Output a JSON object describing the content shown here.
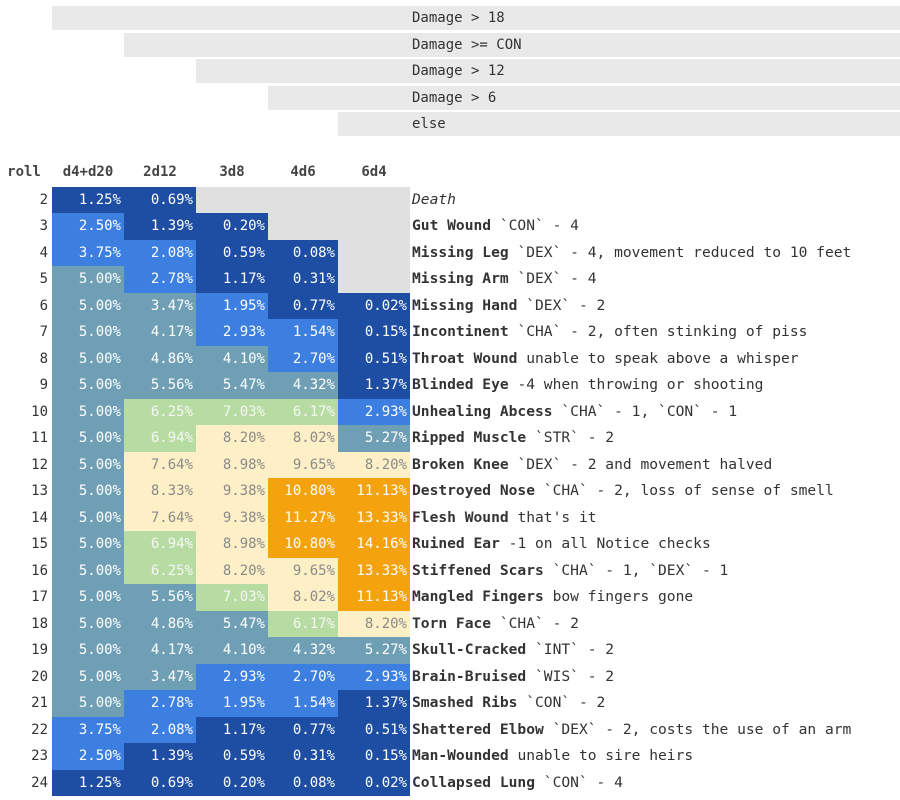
{
  "conditions": [
    "Damage > 18",
    "Damage >= CON",
    "Damage > 12",
    "Damage > 6",
    "else"
  ],
  "headers": [
    "roll",
    "d4+d20",
    "2d12",
    "3d8",
    "4d6",
    "6d4"
  ],
  "colors": {
    "dark_blue": "#1d4ea3",
    "mid_blue": "#3d7fe0",
    "slate_blue": "#6f9fb5",
    "light_green": "#b7dca1",
    "cream": "#fdf0c6",
    "orange": "#f4a20d",
    "gray_bar": "#e9e9e9"
  },
  "rows": [
    {
      "roll": "2",
      "cells": [
        "1.25%",
        "0.69%",
        "",
        "",
        ""
      ],
      "name": "Death",
      "detail": "",
      "italic": true
    },
    {
      "roll": "3",
      "cells": [
        "2.50%",
        "1.39%",
        "0.20%",
        "",
        ""
      ],
      "name": "Gut Wound",
      "detail": " `CON` - 4"
    },
    {
      "roll": "4",
      "cells": [
        "3.75%",
        "2.08%",
        "0.59%",
        "0.08%",
        ""
      ],
      "name": "Missing Leg",
      "detail": " `DEX` - 4, movement reduced to 10 feet"
    },
    {
      "roll": "5",
      "cells": [
        "5.00%",
        "2.78%",
        "1.17%",
        "0.31%",
        ""
      ],
      "name": "Missing Arm",
      "detail": " `DEX` - 4"
    },
    {
      "roll": "6",
      "cells": [
        "5.00%",
        "3.47%",
        "1.95%",
        "0.77%",
        "0.02%"
      ],
      "name": "Missing Hand",
      "detail": " `DEX` - 2"
    },
    {
      "roll": "7",
      "cells": [
        "5.00%",
        "4.17%",
        "2.93%",
        "1.54%",
        "0.15%"
      ],
      "name": "Incontinent",
      "detail": " `CHA` - 2, often stinking of piss"
    },
    {
      "roll": "8",
      "cells": [
        "5.00%",
        "4.86%",
        "4.10%",
        "2.70%",
        "0.51%"
      ],
      "name": "Throat Wound",
      "detail": " unable to speak above a whisper"
    },
    {
      "roll": "9",
      "cells": [
        "5.00%",
        "5.56%",
        "5.47%",
        "4.32%",
        "1.37%"
      ],
      "name": "Blinded Eye",
      "detail": " -4 when throwing or shooting"
    },
    {
      "roll": "10",
      "cells": [
        "5.00%",
        "6.25%",
        "7.03%",
        "6.17%",
        "2.93%"
      ],
      "name": "Unhealing Abcess",
      "detail": " `CHA` - 1, `CON` - 1"
    },
    {
      "roll": "11",
      "cells": [
        "5.00%",
        "6.94%",
        "8.20%",
        "8.02%",
        "5.27%"
      ],
      "name": "Ripped Muscle",
      "detail": " `STR` - 2"
    },
    {
      "roll": "12",
      "cells": [
        "5.00%",
        "7.64%",
        "8.98%",
        "9.65%",
        "8.20%"
      ],
      "name": "Broken Knee",
      "detail": " `DEX` - 2 and movement halved"
    },
    {
      "roll": "13",
      "cells": [
        "5.00%",
        "8.33%",
        "9.38%",
        "10.80%",
        "11.13%"
      ],
      "name": "Destroyed Nose",
      "detail": " `CHA` - 2, loss of sense of smell"
    },
    {
      "roll": "14",
      "cells": [
        "5.00%",
        "7.64%",
        "9.38%",
        "11.27%",
        "13.33%"
      ],
      "name": "Flesh Wound",
      "detail": " that's it"
    },
    {
      "roll": "15",
      "cells": [
        "5.00%",
        "6.94%",
        "8.98%",
        "10.80%",
        "14.16%"
      ],
      "name": "Ruined Ear",
      "detail": " -1 on all Notice checks"
    },
    {
      "roll": "16",
      "cells": [
        "5.00%",
        "6.25%",
        "8.20%",
        "9.65%",
        "13.33%"
      ],
      "name": "Stiffened Scars",
      "detail": " `CHA` - 1, `DEX` - 1"
    },
    {
      "roll": "17",
      "cells": [
        "5.00%",
        "5.56%",
        "7.03%",
        "8.02%",
        "11.13%"
      ],
      "name": "Mangled Fingers",
      "detail": " bow fingers gone"
    },
    {
      "roll": "18",
      "cells": [
        "5.00%",
        "4.86%",
        "5.47%",
        "6.17%",
        "8.20%"
      ],
      "name": "Torn Face",
      "detail": " `CHA` - 2"
    },
    {
      "roll": "19",
      "cells": [
        "5.00%",
        "4.17%",
        "4.10%",
        "4.32%",
        "5.27%"
      ],
      "name": "Skull-Cracked",
      "detail": " `INT` - 2"
    },
    {
      "roll": "20",
      "cells": [
        "5.00%",
        "3.47%",
        "2.93%",
        "2.70%",
        "2.93%"
      ],
      "name": "Brain-Bruised",
      "detail": " `WIS` - 2"
    },
    {
      "roll": "21",
      "cells": [
        "5.00%",
        "2.78%",
        "1.95%",
        "1.54%",
        "1.37%"
      ],
      "name": "Smashed Ribs",
      "detail": " `CON` - 2"
    },
    {
      "roll": "22",
      "cells": [
        "3.75%",
        "2.08%",
        "1.17%",
        "0.77%",
        "0.51%"
      ],
      "name": "Shattered Elbow",
      "detail": " `DEX` - 2, costs the use of an arm"
    },
    {
      "roll": "23",
      "cells": [
        "2.50%",
        "1.39%",
        "0.59%",
        "0.31%",
        "0.15%"
      ],
      "name": "Man-Wounded",
      "detail": " unable to sire heirs"
    },
    {
      "roll": "24",
      "cells": [
        "1.25%",
        "0.69%",
        "0.20%",
        "0.08%",
        "0.02%"
      ],
      "name": "Collapsed Lung",
      "detail": " `CON` - 4"
    }
  ]
}
